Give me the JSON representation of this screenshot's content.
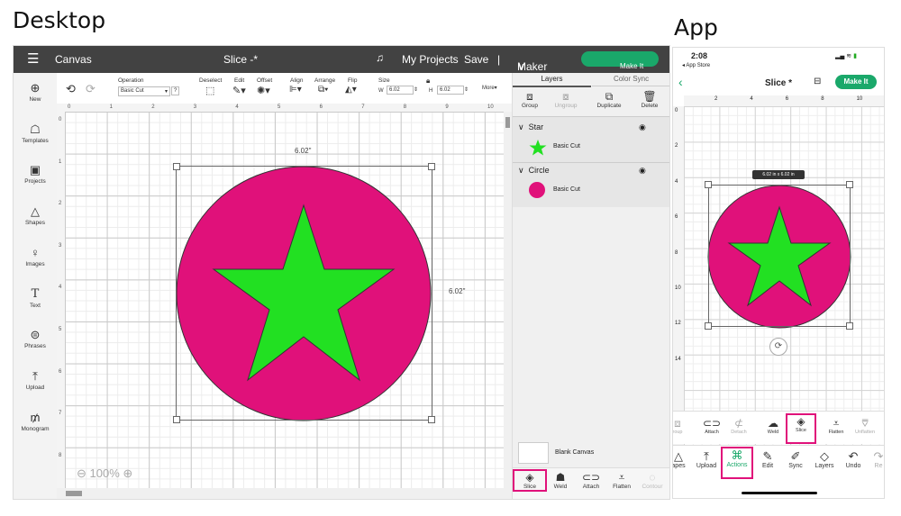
{
  "labels": {
    "desktop": "Desktop",
    "app": "App"
  },
  "desktop": {
    "topbar": {
      "menu_icon": "hamburger-icon",
      "canvas": "Canvas",
      "title": "Slice -*",
      "my_projects": "My Projects",
      "save": "Save",
      "divider": "|",
      "machine": "Maker 3",
      "make_it": "Make It"
    },
    "toolbar": {
      "operation_label": "Operation",
      "operation_value": "Basic Cut",
      "operation_help": "?",
      "deselect": "Deselect",
      "edit": "Edit",
      "offset": "Offset",
      "align": "Align",
      "arrange": "Arrange",
      "flip": "Flip",
      "size_label": "Size",
      "w_label": "W",
      "w_value": "6.02",
      "h_label": "H",
      "h_value": "6.02",
      "more": "More"
    },
    "leftbar": [
      "New",
      "Templates",
      "Projects",
      "Shapes",
      "Images",
      "Text",
      "Phrases",
      "Upload",
      "Monogram"
    ],
    "ruler_h": [
      "0",
      "1",
      "2",
      "3",
      "4",
      "5",
      "6",
      "7",
      "8",
      "9",
      "10"
    ],
    "ruler_v": [
      "0",
      "1",
      "2",
      "3",
      "4",
      "5",
      "6",
      "7",
      "8"
    ],
    "dims": {
      "top": "6.02\"",
      "right": "6.02\""
    },
    "zoom": "100%",
    "panel": {
      "tabs": [
        "Layers",
        "Color Sync"
      ],
      "tools": [
        "Group",
        "Ungroup",
        "Duplicate",
        "Delete"
      ],
      "layers": [
        {
          "name": "Star",
          "op": "Basic Cut",
          "color": "#22e022"
        },
        {
          "name": "Circle",
          "op": "Basic Cut",
          "color": "#e0117a"
        }
      ],
      "blank_canvas": "Blank Canvas",
      "bottom": [
        "Slice",
        "Weld",
        "Attach",
        "Flatten",
        "Contour"
      ]
    },
    "colors": {
      "star": "#22e022",
      "circle": "#e0117a",
      "accent": "#1aa86a"
    }
  },
  "app": {
    "time": "2:08",
    "back": "◂ App Store",
    "title": "Slice *",
    "make_it": "Make It",
    "ruler_h": [
      "2",
      "4",
      "6",
      "8",
      "10"
    ],
    "ruler_v": [
      "0",
      "2",
      "4",
      "6",
      "8",
      "10",
      "12",
      "14"
    ],
    "size_tag": "6.02 in x 6.02 in",
    "tools": [
      "roup",
      "Attach",
      "Detach",
      "Weld",
      "Slice",
      "Flatten",
      "Unflatten"
    ],
    "nav": [
      "apes",
      "Upload",
      "Actions",
      "Edit",
      "Sync",
      "Layers",
      "Undo",
      "Re"
    ]
  }
}
